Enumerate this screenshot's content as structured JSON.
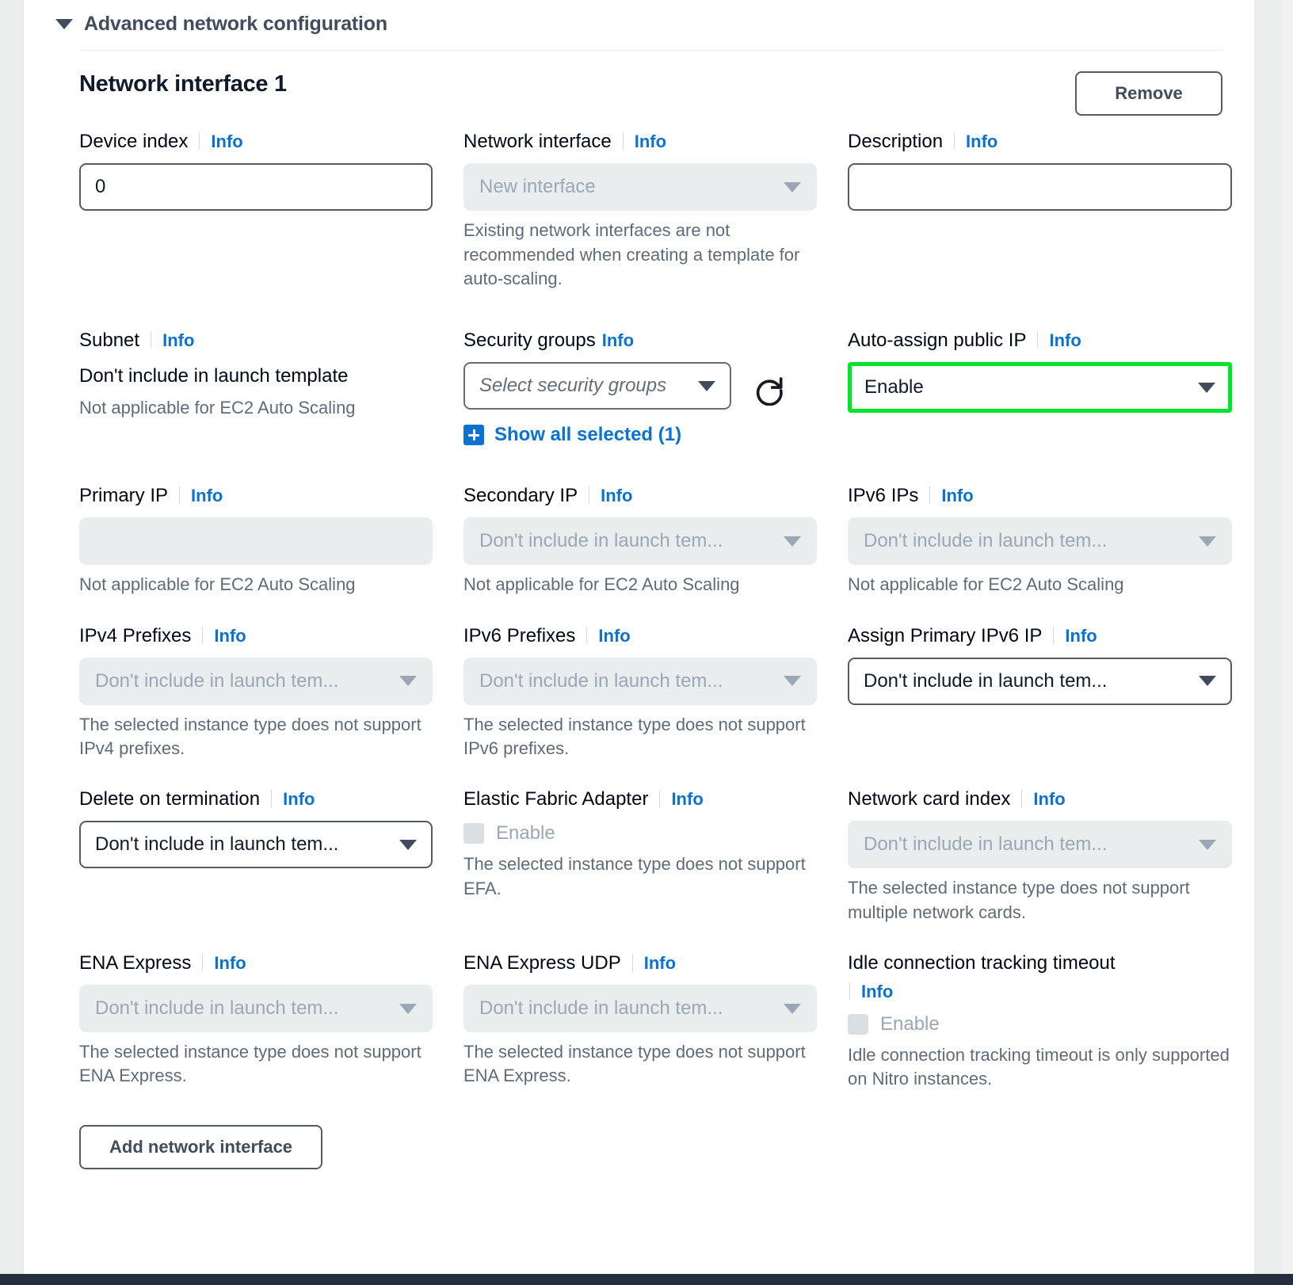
{
  "section": {
    "title": "Advanced network configuration",
    "caret_icon": "caret-down-icon"
  },
  "interface": {
    "title": "Network interface 1",
    "remove_label": "Remove"
  },
  "labels": {
    "info": "Info"
  },
  "fields": {
    "device_index": {
      "label": "Device index",
      "info": "Info",
      "value": "0"
    },
    "network_interface": {
      "label": "Network interface",
      "info": "Info",
      "value": "New interface",
      "help": "Existing network interfaces are not recommended when creating a template for auto-scaling."
    },
    "description": {
      "label": "Description",
      "info": "Info",
      "value": "",
      "placeholder": ""
    },
    "subnet": {
      "label": "Subnet",
      "info": "Info",
      "value": "Don't include in launch template",
      "help": "Not applicable for EC2 Auto Scaling"
    },
    "security_groups": {
      "label": "Security groups",
      "info": "Info",
      "placeholder": "Select security groups",
      "refresh_icon": "refresh-icon",
      "show_all_label": "Show all selected (1)",
      "show_all_icon": "plus-box-icon"
    },
    "auto_assign_public_ip": {
      "label": "Auto-assign public IP",
      "info": "Info",
      "value": "Enable",
      "highlight_color": "#00e526"
    },
    "primary_ip": {
      "label": "Primary IP",
      "info": "Info",
      "value": "",
      "help": "Not applicable for EC2 Auto Scaling"
    },
    "secondary_ip": {
      "label": "Secondary IP",
      "info": "Info",
      "value": "Don't include in launch tem...",
      "help": "Not applicable for EC2 Auto Scaling"
    },
    "ipv6_ips": {
      "label": "IPv6 IPs",
      "info": "Info",
      "value": "Don't include in launch tem...",
      "help": "Not applicable for EC2 Auto Scaling"
    },
    "ipv4_prefixes": {
      "label": "IPv4 Prefixes",
      "info": "Info",
      "value": "Don't include in launch tem...",
      "help": "The selected instance type does not support IPv4 prefixes."
    },
    "ipv6_prefixes": {
      "label": "IPv6 Prefixes",
      "info": "Info",
      "value": "Don't include in launch tem...",
      "help": "The selected instance type does not support IPv6 prefixes."
    },
    "assign_primary_ipv6_ip": {
      "label": "Assign Primary IPv6 IP",
      "info": "Info",
      "value": "Don't include in launch tem...",
      "help": ""
    },
    "delete_on_termination": {
      "label": "Delete on termination",
      "info": "Info",
      "value": "Don't include in launch tem...",
      "help": ""
    },
    "elastic_fabric_adapter": {
      "label": "Elastic Fabric Adapter",
      "info": "Info",
      "checkbox_label": "Enable",
      "help": "The selected instance type does not support EFA."
    },
    "network_card_index": {
      "label": "Network card index",
      "info": "Info",
      "value": "Don't include in launch tem...",
      "help": "The selected instance type does not support multiple network cards."
    },
    "ena_express": {
      "label": "ENA Express",
      "info": "Info",
      "value": "Don't include in launch tem...",
      "help": "The selected instance type does not support ENA Express."
    },
    "ena_express_udp": {
      "label": "ENA Express UDP",
      "info": "Info",
      "value": "Don't include in launch tem...",
      "help": "The selected instance type does not support ENA Express."
    },
    "idle_connection_tracking_timeout": {
      "label": "Idle connection tracking timeout",
      "info": "Info",
      "checkbox_label": "Enable",
      "help": "Idle connection tracking timeout is only supported on Nitro instances."
    }
  },
  "footer": {
    "add_interface_label": "Add network interface"
  }
}
